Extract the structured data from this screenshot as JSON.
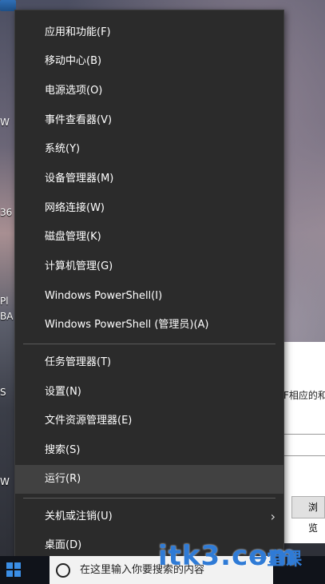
{
  "desktop": {
    "icon_labels": [
      "W",
      "36",
      "BA",
      "Pl",
      "S",
      "W"
    ]
  },
  "dialog": {
    "partial_text": "F相应的和",
    "browse_button_partial": "浏览"
  },
  "taskbar": {
    "search_text": "在这里输入你要搜索的内容"
  },
  "menu": {
    "items_group1": [
      {
        "label": "应用和功能(F)"
      },
      {
        "label": "移动中心(B)"
      },
      {
        "label": "电源选项(O)"
      },
      {
        "label": "事件查看器(V)"
      },
      {
        "label": "系统(Y)"
      },
      {
        "label": "设备管理器(M)"
      },
      {
        "label": "网络连接(W)"
      },
      {
        "label": "磁盘管理(K)"
      },
      {
        "label": "计算机管理(G)"
      },
      {
        "label": "Windows PowerShell(I)"
      },
      {
        "label": "Windows PowerShell (管理员)(A)"
      }
    ],
    "items_group2": [
      {
        "label": "任务管理器(T)"
      },
      {
        "label": "设置(N)"
      },
      {
        "label": "文件资源管理器(E)"
      },
      {
        "label": "搜索(S)"
      },
      {
        "label": "运行(R)"
      }
    ],
    "items_group3": [
      {
        "label": "关机或注销(U)"
      },
      {
        "label": "桌面(D)"
      }
    ],
    "highlighted": "运行(R)"
  },
  "watermark": {
    "text": "itk3.com",
    "sub": "一堂课"
  }
}
